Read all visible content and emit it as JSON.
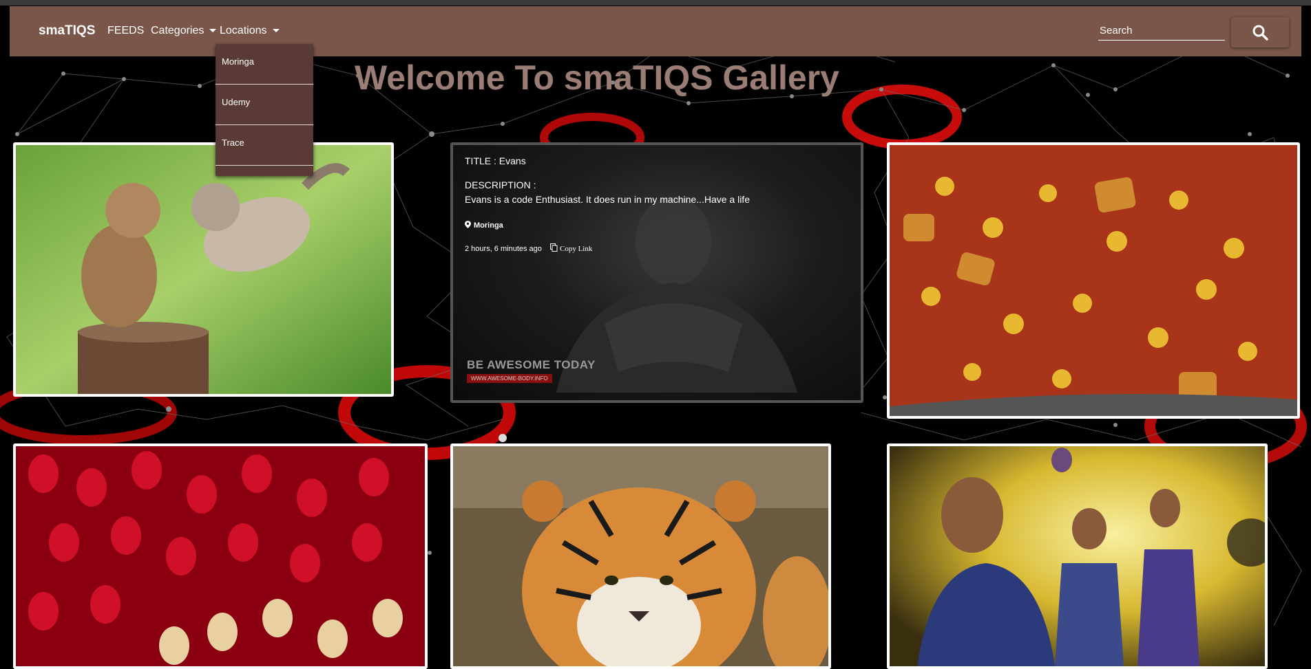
{
  "navbar": {
    "brand": "smaTIQS",
    "links": {
      "feeds": "FEEDS",
      "categories": "Categories",
      "locations": "Locations"
    },
    "search_placeholder": "Search",
    "search_icon": "search-icon",
    "background_color": "#7a554a"
  },
  "locations_menu": {
    "items": [
      "Moringa",
      "Udemy",
      "Trace"
    ]
  },
  "hero": {
    "title": "Welcome To smaTIQS Gallery",
    "color": "#9a7d74"
  },
  "gallery": {
    "images": [
      "kittens-playing",
      "food-stew",
      "pomegranate-seeds",
      "tiger",
      "basketball-players"
    ],
    "info_card": {
      "title_label": "TITLE : Evans",
      "description_label": "DESCRIPTION :",
      "description": "Evans is a code Enthusiast. It does run in my machine...Have a life",
      "location": "Moringa",
      "location_icon": "map-pin-icon",
      "time_ago": "2 hours, 6 minutes ago",
      "copy_icon": "copy-icon",
      "copy_link": "Copy Link",
      "image_caption": "BE AWESOME TODAY",
      "image_caption_url": "WWW.AWESOME-BODY.INFO"
    }
  }
}
